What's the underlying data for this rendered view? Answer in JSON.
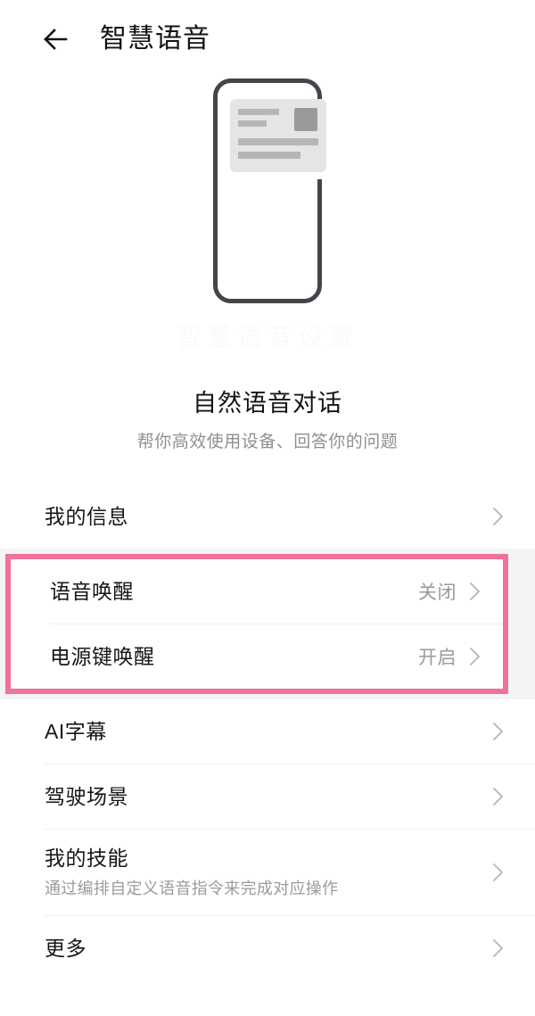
{
  "header": {
    "back_icon": "back-arrow-icon",
    "title": "智慧语音"
  },
  "hero": {
    "illustration_name": "phone-voice-card-illustration",
    "watermark": "智慧语音设置",
    "title": "自然语音对话",
    "subtitle": "帮你高效使用设备、回答你的问题"
  },
  "colors": {
    "highlight": "#f0729a",
    "text_primary": "#161616",
    "text_secondary": "#9a9a9a",
    "background": "#ffffff",
    "gap": "#f4f4f4"
  },
  "sections": [
    {
      "name": "profile",
      "highlighted": false,
      "rows": [
        {
          "label": "我的信息",
          "value": "",
          "desc": "",
          "chevron": true
        }
      ]
    },
    {
      "name": "wakeup",
      "highlighted": true,
      "rows": [
        {
          "label": "语音唤醒",
          "value": "关闭",
          "desc": "",
          "chevron": true
        },
        {
          "label": "电源键唤醒",
          "value": "开启",
          "desc": "",
          "chevron": true
        }
      ]
    },
    {
      "name": "features",
      "highlighted": false,
      "rows": [
        {
          "label": "AI字幕",
          "value": "",
          "desc": "",
          "chevron": true
        },
        {
          "label": "驾驶场景",
          "value": "",
          "desc": "",
          "chevron": true
        },
        {
          "label": "我的技能",
          "value": "",
          "desc": "通过编排自定义语音指令来完成对应操作",
          "chevron": true
        },
        {
          "label": "更多",
          "value": "",
          "desc": "",
          "chevron": true
        }
      ]
    }
  ]
}
